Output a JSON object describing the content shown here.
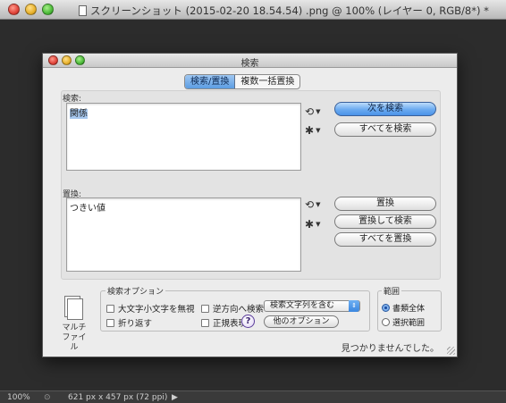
{
  "app": {
    "title": "スクリーンショット (2015-02-20 18.54.54) .png @ 100% (レイヤー 0, RGB/8*) *",
    "status": {
      "zoom": "100%",
      "size": "621 px x 457 px (72 ppi)"
    }
  },
  "dialog": {
    "title": "検索",
    "tabs": [
      "検索/置換",
      "複数一括置換"
    ],
    "search_label": "検索:",
    "search_value": "関係",
    "replace_label": "置換:",
    "replace_value": "つきい値",
    "buttons": {
      "find_next": "次を検索",
      "find_all": "すべてを検索",
      "replace": "置換",
      "replace_and_find": "置換して検索",
      "replace_all": "すべてを置換"
    },
    "options": {
      "title": "検索オプション",
      "case_sensitive": "大文字小文字を無視",
      "reverse": "逆方向へ検索",
      "wrap": "折り返す",
      "regex": "正規表現",
      "match_select": "検索文字列を含む",
      "help": "?",
      "other_options": "他のオプション"
    },
    "scope": {
      "title": "範囲",
      "whole_document": "書類全体",
      "selection": "選択範囲",
      "selected": "whole_document"
    },
    "multi_file": [
      "マルチ",
      "ファイル"
    ],
    "message": "見つかりませんでした。"
  }
}
